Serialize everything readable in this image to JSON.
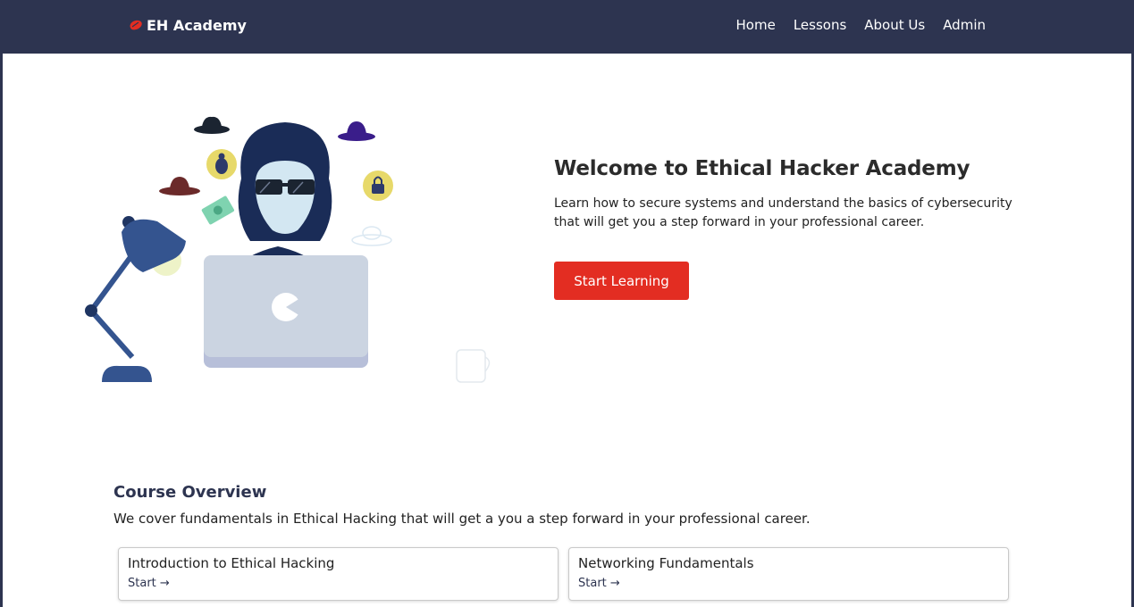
{
  "nav": {
    "brand": "EH Academy",
    "links": [
      "Home",
      "Lessons",
      "About Us",
      "Admin"
    ]
  },
  "hero": {
    "title": "Welcome to Ethical Hacker Academy",
    "subtitle": "Learn how to secure systems and understand the basics of cybersecurity that will get you a step forward in your professional career.",
    "cta_label": "Start Learning"
  },
  "overview": {
    "title": "Course Overview",
    "text": "We cover fundamentals in Ethical Hacking that will get a you a step forward in your professional career.",
    "courses": [
      {
        "title": "Introduction to Ethical Hacking",
        "link_label": "Start →"
      },
      {
        "title": "Networking Fundamentals",
        "link_label": "Start →"
      }
    ]
  },
  "colors": {
    "navbar": "#2d3450",
    "accent": "#e32d22"
  }
}
